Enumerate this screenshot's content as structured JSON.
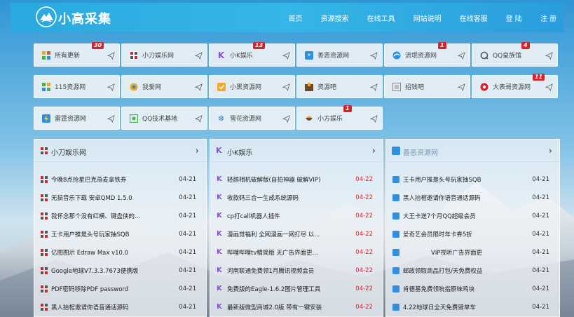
{
  "site": {
    "brand": "小高采集"
  },
  "nav": [
    "首页",
    "资源搜索",
    "在线工具",
    "网站说明",
    "在线客服",
    "登 陆",
    "注 册"
  ],
  "tiles": [
    {
      "label": "所有更新",
      "icon": "grid-color-icon",
      "badge": "30"
    },
    {
      "label": "小刀娱乐网",
      "icon": "xiaodao-logo-icon",
      "badge": ""
    },
    {
      "label": "小K娱乐",
      "icon": "k-logo-icon",
      "badge": "13"
    },
    {
      "label": "善恶资源网",
      "icon": "blue-square-icon",
      "badge": ""
    },
    {
      "label": "流氓资源网",
      "icon": "swirl-logo-icon",
      "badge": "1"
    },
    {
      "label": "QQ皇族馆",
      "icon": "q-logo-icon",
      "badge": "4"
    },
    {
      "label": "115资源网",
      "icon": "grid-color-icon",
      "badge": ""
    },
    {
      "label": "我爱网",
      "icon": "circle-logo-icon",
      "badge": ""
    },
    {
      "label": "小黑资源网",
      "icon": "orange-check-icon",
      "badge": ""
    },
    {
      "label": "资源吧",
      "icon": "box-icon",
      "badge": ""
    },
    {
      "label": "招钱吧",
      "icon": "grey-square-icon",
      "badge": ""
    },
    {
      "label": "大表哥资源网",
      "icon": "red-circle-icon",
      "badge": "11"
    },
    {
      "label": "雷霆资源网",
      "icon": "thunder-logo-icon",
      "badge": ""
    },
    {
      "label": "QQ技术基地",
      "icon": "qq-frame-icon",
      "badge": ""
    },
    {
      "label": "雪花资源网",
      "icon": "snowflake-icon",
      "badge": ""
    },
    {
      "label": "小方娱乐",
      "icon": "bowl-logo-icon",
      "badge": "1"
    }
  ],
  "panels": [
    {
      "title": "小刀娱乐网",
      "rows": [
        {
          "text": "今晚8点抢星巴克燕麦拿铁券",
          "date": "04-21"
        },
        {
          "text": "无损音乐下载 安卓QMD 1.5.0",
          "date": "04-21"
        },
        {
          "text": "我怀念那个没有红横、键盘侠的...",
          "date": "04-21"
        },
        {
          "text": "王卡用户推是头号玩家抽SQB",
          "date": "04-21"
        },
        {
          "text": "亿图图示 Edraw Max v10.0",
          "date": "04-21"
        },
        {
          "text": "Google地球V7.3.3.7673便携版",
          "date": "04-21"
        },
        {
          "text": "PDF密码移除PDF password",
          "date": "04-21"
        },
        {
          "text": "黑人抬棺邀请你语音通话源码",
          "date": "04-21"
        }
      ]
    },
    {
      "title": "小K娱乐",
      "rows": [
        {
          "text": "轻颜相机破解版(自拍神器 破解VIP)",
          "date": "04-22"
        },
        {
          "text": "收款码三合一生成系统源码",
          "date": "04-22"
        },
        {
          "text": "cp打call机器人插件",
          "date": "04-22"
        },
        {
          "text": "漫画觉福利 全网漫画一网打尽 以...",
          "date": "04-22"
        },
        {
          "text": "哔哩哔哩tv精简版 无广告界面更...",
          "date": "04-22"
        },
        {
          "text": "河南联通免费领1月腾讯视频会员",
          "date": "04-22"
        },
        {
          "text": "免费版的Eagle-1.6.2图片管理工具",
          "date": "04-22"
        },
        {
          "text": "最新版微型商城2.0版 带有一键安装",
          "date": "04-22"
        }
      ]
    },
    {
      "title": "善恶资源网",
      "rows": [
        {
          "text": "王卡用户推是头号玩家抽SQB",
          "date": "04-21"
        },
        {
          "text": "黑人抬棺邀请你语音通话源码",
          "date": "04-21"
        },
        {
          "text": "大王卡送7个月QQ超级会员",
          "date": "04-21"
        },
        {
          "text": "爱奇艺会员限时年卡券5折",
          "date": "04-21"
        },
        {
          "text": "VIP视听广告界面更",
          "date": "04-21"
        },
        {
          "text": "邮政领取商品打包/天免费权益",
          "date": "04-21"
        },
        {
          "text": "肯德基免费领吮指原味鸡块",
          "date": "04-21"
        },
        {
          "text": "4.22地球日全天免费骑单车",
          "date": "04-21"
        }
      ]
    }
  ],
  "colors": {
    "header": "#2aa9e0",
    "badge": "#d8222b",
    "date_red": "#d8222b"
  }
}
